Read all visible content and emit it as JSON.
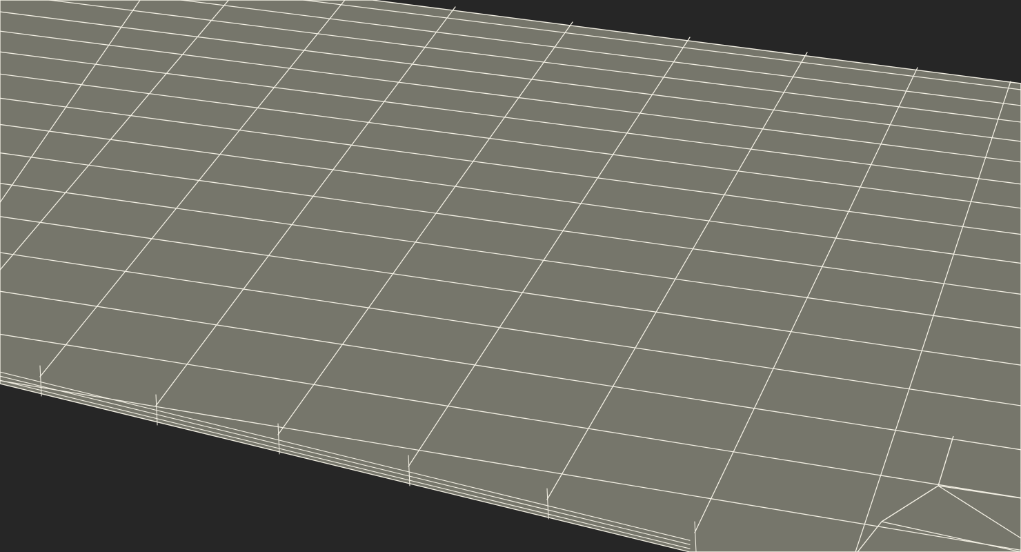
{
  "viewport": {
    "background_color": "#262626",
    "surface_color": "#76766b",
    "wire_color": "#f2efe3"
  },
  "mesh": {
    "description_label": "",
    "visible_text": []
  }
}
